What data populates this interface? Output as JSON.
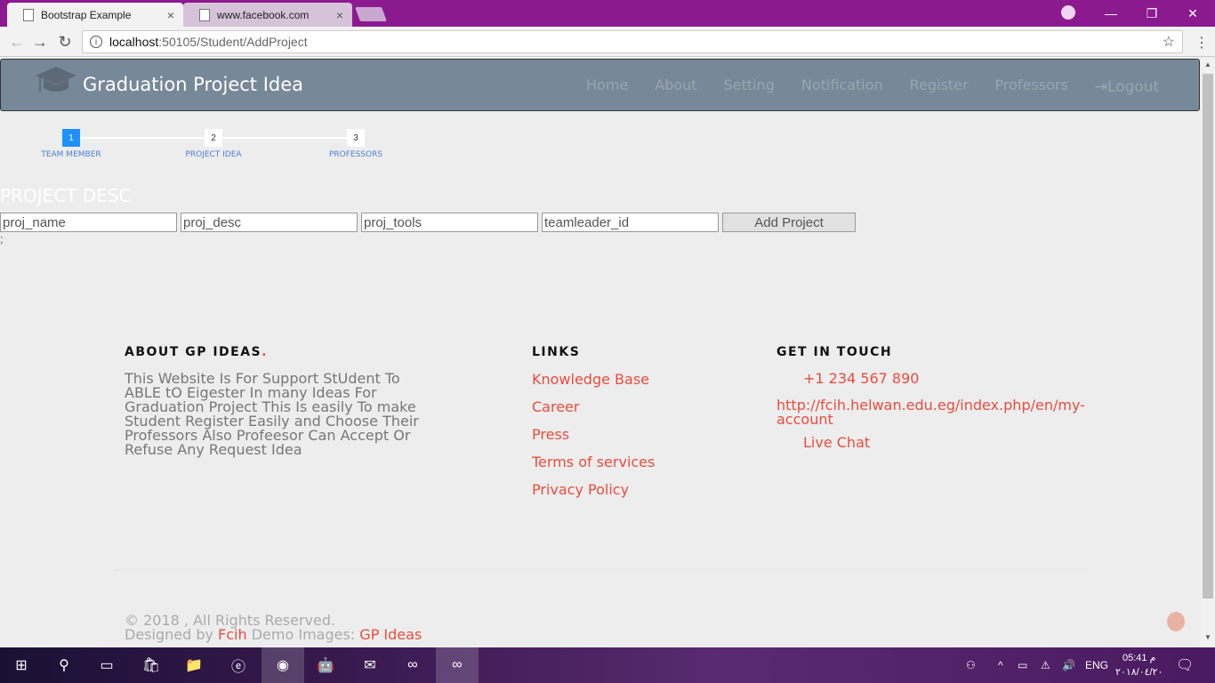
{
  "browser": {
    "tabs": [
      {
        "title": "Bootstrap Example",
        "active": true
      },
      {
        "title": "www.facebook.com",
        "active": false
      }
    ],
    "url_host": "localhost",
    "url_path": ":50105/Student/AddProject",
    "close_glyph": "×"
  },
  "site": {
    "brand": "Graduation Project Idea",
    "menu": [
      "Home",
      "About",
      "Setting",
      "Notification",
      "Register",
      "Professors"
    ],
    "logout_label": "Logout"
  },
  "wizard": {
    "steps": [
      {
        "num": "1",
        "label": "TEAM MEMBER",
        "active": true
      },
      {
        "num": "2",
        "label": "PROJECT IDEA",
        "active": false
      },
      {
        "num": "3",
        "label": "PROFESSORS",
        "active": false
      }
    ]
  },
  "form": {
    "title": "PROJECT DESC",
    "fields": [
      {
        "placeholder": "proj_name"
      },
      {
        "placeholder": "proj_desc"
      },
      {
        "placeholder": "proj_tools"
      },
      {
        "placeholder": "teamleader_id"
      }
    ],
    "submit_label": "Add Project",
    "trailing_text": ";"
  },
  "footer": {
    "about_title": "ABOUT GP IDEAS",
    "about_dot": ".",
    "about_text": "This Website Is For Support StUdent To ABLE tO Eigester In many Ideas For Graduation Project This Is easily To make Student Register Easily and Choose Their Professors Also Profeesor Can Accept Or Refuse Any Request Idea",
    "links_title": "LINKS",
    "links": [
      "Knowledge Base",
      "Career",
      "Press",
      "Terms of services",
      "Privacy Policy"
    ],
    "touch_title": "GET IN TOUCH",
    "phone": "+1 234 567 890",
    "website": "http://fcih.helwan.edu.eg/index.php/en/my-account",
    "chat": "Live Chat",
    "copyright": "© 2018 , All Rights Reserved.",
    "designed_by": "Designed by",
    "designer": "Fcih",
    "demo_images": "Demo Images:",
    "demo_source": "GP Ideas"
  },
  "taskbar": {
    "lang": "ENG",
    "time": "05:41 م",
    "date": "٢٠١٨/٠٤/٢٠"
  },
  "colors": {
    "navbar": "#778899",
    "accent": "#e84c3d",
    "step_active": "#1e90ff",
    "tab_strip": "#8b1a8f"
  }
}
